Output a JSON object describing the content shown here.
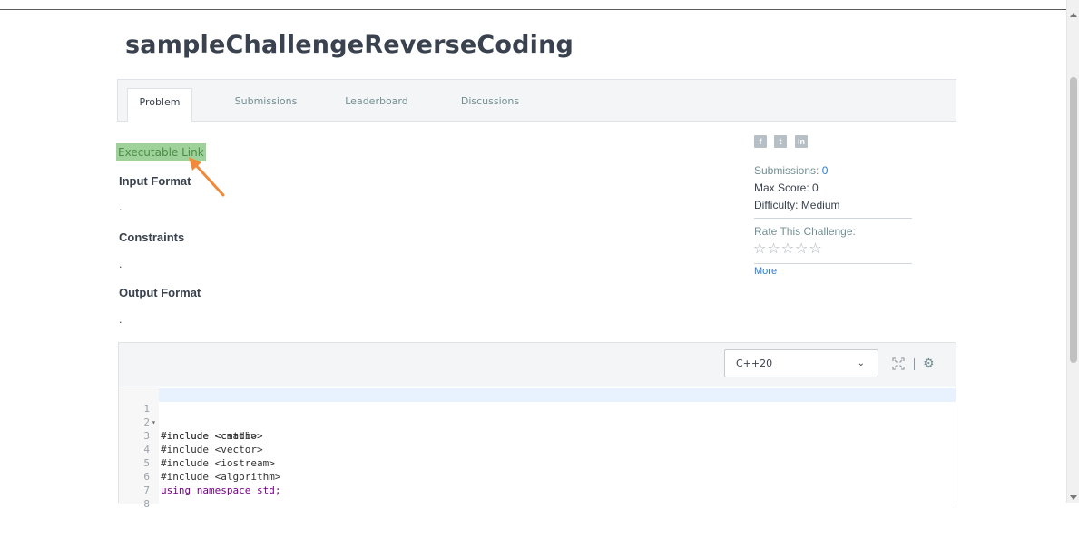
{
  "page": {
    "title": "sampleChallengeReverseCoding"
  },
  "tabs": [
    {
      "label": "Problem",
      "active": true
    },
    {
      "label": "Submissions",
      "active": false
    },
    {
      "label": "Leaderboard",
      "active": false
    },
    {
      "label": "Discussions",
      "active": false
    }
  ],
  "problem": {
    "executable_link": "Executable Link",
    "input_format_label": "Input Format",
    "input_format_text": ".",
    "constraints_label": "Constraints",
    "constraints_text": ".",
    "output_format_label": "Output Format",
    "output_format_text": "."
  },
  "sidebar": {
    "social": [
      {
        "name": "facebook-icon",
        "glyph": "f"
      },
      {
        "name": "twitter-icon",
        "glyph": "t"
      },
      {
        "name": "linkedin-icon",
        "glyph": "in"
      }
    ],
    "submissions_label": "Submissions:",
    "submissions_value": "0",
    "max_score_label": "Max Score:",
    "max_score_value": "0",
    "difficulty_label": "Difficulty:",
    "difficulty_value": "Medium",
    "rate_label": "Rate This Challenge:",
    "rating_stars": 5,
    "rating_value": 0,
    "more_label": "More"
  },
  "editor": {
    "language": "C++20",
    "lines": [
      {
        "num": "1",
        "text": "#include <cmath>"
      },
      {
        "num": "2",
        "text": "#include <cstdio>"
      },
      {
        "num": "3",
        "text": "#include <vector>"
      },
      {
        "num": "4",
        "text": "#include <iostream>"
      },
      {
        "num": "5",
        "text": "#include <algorithm>"
      },
      {
        "num": "6",
        "text": "using namespace std;"
      },
      {
        "num": "7",
        "text": ""
      },
      {
        "num": "8",
        "text": ""
      }
    ]
  },
  "colors": {
    "highlight": "#9fd19a",
    "annotation_arrow": "#f08a3a",
    "link_blue": "#2a7ed2"
  }
}
